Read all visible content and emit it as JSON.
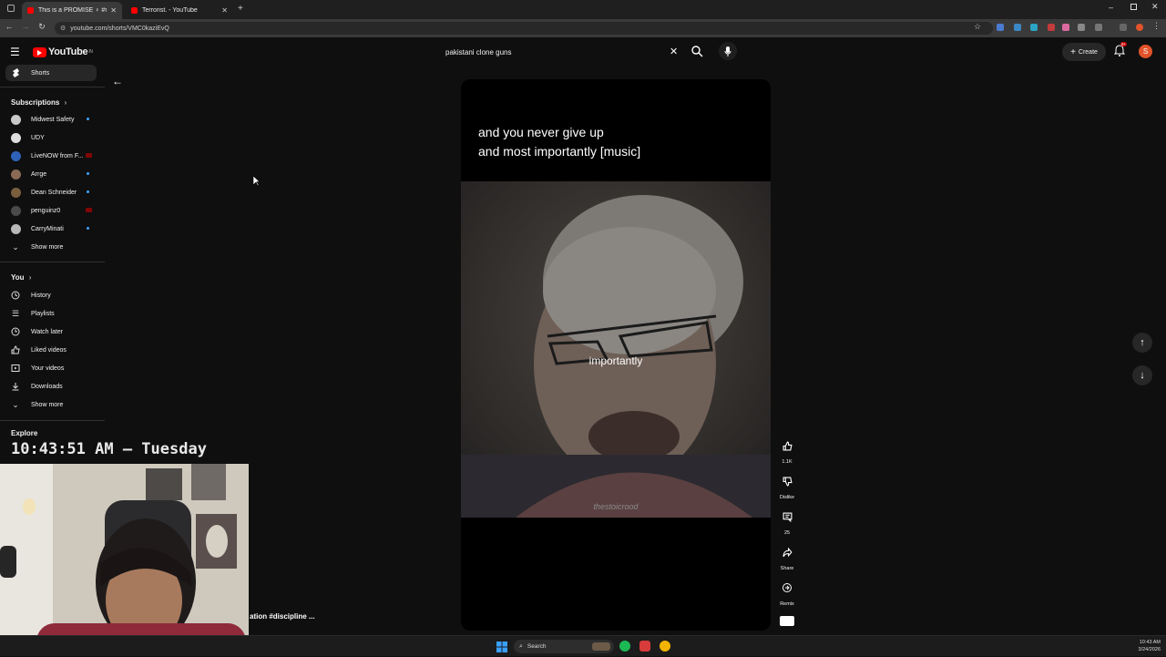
{
  "browser": {
    "tabs": [
      {
        "title": "This is a PROMISE ♀ #mo",
        "active": true
      },
      {
        "title": "Terrorist. - YouTube",
        "active": false
      }
    ],
    "url": "youtube.com/shorts/VMC0kaziEvQ"
  },
  "header": {
    "logo_text": "YouTube",
    "logo_sup": "IN",
    "search_value": "pakistani clone guns",
    "create_label": "Create",
    "avatar_letter": "S",
    "notification_count": "9+"
  },
  "sidebar": {
    "shorts_label": "Shorts",
    "subscriptions_title": "Subscriptions",
    "subscriptions": [
      {
        "name": "Midwest Safety",
        "badge": "dot"
      },
      {
        "name": "UDY",
        "badge": ""
      },
      {
        "name": "LiveNOW from F...",
        "badge": "live"
      },
      {
        "name": "Arrge",
        "badge": "dot"
      },
      {
        "name": "Dean Schneider",
        "badge": "dot"
      },
      {
        "name": "penguinz0",
        "badge": "live"
      },
      {
        "name": "CarryMinati",
        "badge": "dot"
      }
    ],
    "show_more_1": "Show more",
    "you_title": "You",
    "you_items": [
      {
        "label": "History",
        "icon": "history-icon"
      },
      {
        "label": "Playlists",
        "icon": "playlists-icon"
      },
      {
        "label": "Watch later",
        "icon": "watch-later-icon"
      },
      {
        "label": "Liked videos",
        "icon": "liked-icon"
      },
      {
        "label": "Your videos",
        "icon": "your-videos-icon"
      },
      {
        "label": "Downloads",
        "icon": "download-icon"
      }
    ],
    "show_more_2": "Show more",
    "explore_title": "Explore"
  },
  "overlay": {
    "clock": "10:43:51 AM — Tuesday",
    "video_title_fragment": "ation #discipline ..."
  },
  "short": {
    "caption_line1": "and you never give up",
    "caption_line2": "and most importantly [music]",
    "in_video_subtitle": "importantly",
    "watermark": "thestoicrood",
    "like_count": "1.1K",
    "dislike_label": "Dislike",
    "comment_count": "25",
    "share_label": "Share",
    "remix_label": "Remix"
  },
  "taskbar": {
    "search_label": "Search",
    "time": "10:43 AM",
    "date": "3/24/2026"
  }
}
